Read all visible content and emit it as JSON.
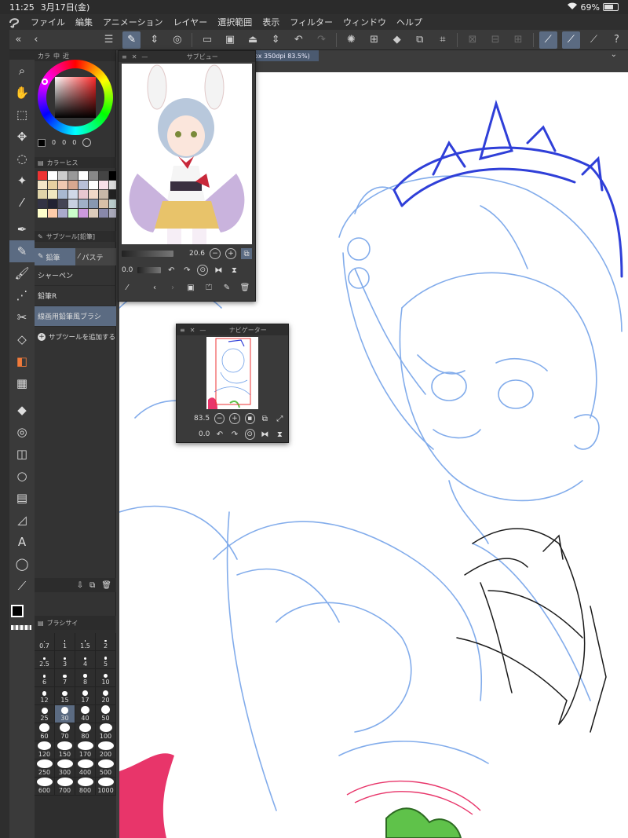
{
  "status": {
    "time": "11:25",
    "date": "3月17日(金)",
    "wifi_icon": "wifi-icon",
    "battery_pct": "69%",
    "battery_level": 0.69
  },
  "menu": {
    "logo_icon": "clip-studio-logo-icon",
    "items": [
      "ファイル",
      "編集",
      "アニメーション",
      "レイヤー",
      "選択範囲",
      "表示",
      "フィルター",
      "ウィンドウ",
      "ヘルプ"
    ]
  },
  "panels": {
    "color_tabs": [
      "カラ",
      "中",
      "近"
    ],
    "color_values": [
      "0",
      "0",
      "0"
    ],
    "history_tab": "カラーヒス",
    "subtool_header": "サブツール[鉛筆]",
    "subtool_tabs": [
      "鉛筆",
      "パステ"
    ],
    "subtool_items": [
      "シャーペン",
      "鉛筆R",
      "線画用鉛筆風ブラシ"
    ],
    "add_subtool": "サブツールを追加する",
    "brush_size_header": "ブラシサイ",
    "brush_sizes": [
      "0.7",
      "1",
      "1.5",
      "2",
      "2.5",
      "3",
      "4",
      "5",
      "6",
      "7",
      "8",
      "10",
      "12",
      "15",
      "17",
      "20",
      "25",
      "30",
      "40",
      "50",
      "60",
      "70",
      "80",
      "100",
      "120",
      "150",
      "170",
      "200",
      "250",
      "300",
      "400",
      "500",
      "600",
      "700",
      "800",
      "1000"
    ],
    "selected_brush_size": "30"
  },
  "document": {
    "tab_label": "A4 2894 x 4093px 350dpi 83.5%)"
  },
  "subview": {
    "title": "サブビュー",
    "zoom_value": "20.6",
    "rotate_value": "0.0"
  },
  "navigator": {
    "title": "ナビゲーター",
    "zoom_value": "83.5",
    "rotate_value": "0.0"
  },
  "colors": {
    "accent": "#5b6b82",
    "sketch_blue": "#6d9ee8",
    "sketch_dark_blue": "#2f3fd8",
    "sketch_red": "#e8356a",
    "sketch_green": "#5fc24a"
  }
}
